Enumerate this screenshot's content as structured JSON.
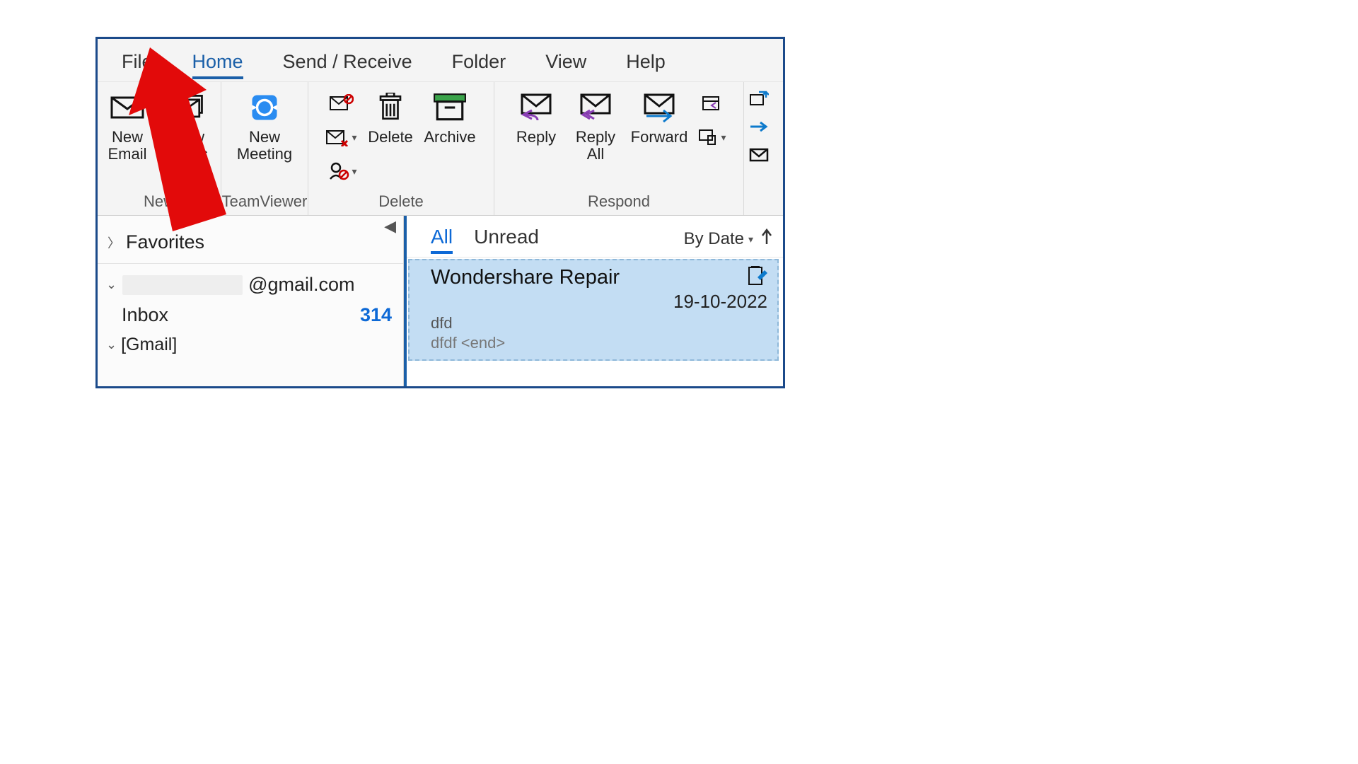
{
  "tabs": {
    "file": "File",
    "home": "Home",
    "send_receive": "Send / Receive",
    "folder": "Folder",
    "view": "View",
    "help": "Help",
    "active": "home"
  },
  "ribbon": {
    "new_group": {
      "label": "New",
      "new_email": "New\nEmail",
      "new_items": "New\nItems"
    },
    "teamviewer_group": {
      "label": "TeamViewer",
      "new_meeting": "New\nMeeting"
    },
    "delete_group": {
      "label": "Delete",
      "delete": "Delete",
      "archive": "Archive"
    },
    "respond_group": {
      "label": "Respond",
      "reply": "Reply",
      "reply_all": "Reply\nAll",
      "forward": "Forward"
    }
  },
  "nav": {
    "favorites": "Favorites",
    "account_suffix": "@gmail.com",
    "inbox": {
      "label": "Inbox",
      "count": "314"
    },
    "gmail_folder": "[Gmail]"
  },
  "msg_header": {
    "all": "All",
    "unread": "Unread",
    "sort": "By Date"
  },
  "message": {
    "sender": "Wondershare Repair",
    "date": "19-10-2022",
    "subject": "dfd",
    "preview": "dfdf <end>"
  }
}
